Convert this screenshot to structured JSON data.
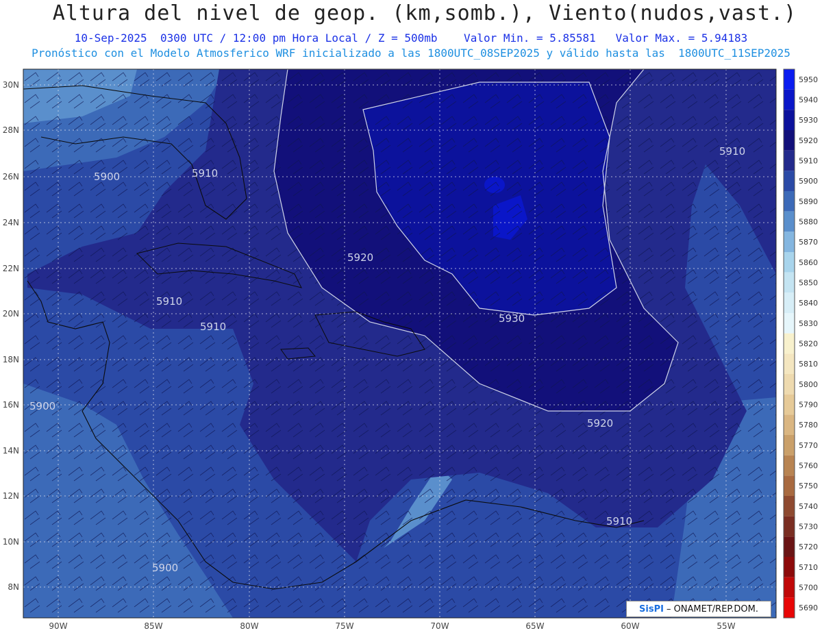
{
  "header": {
    "title": "Altura del nivel de geop. (km,somb.), Viento(nudos,vast.)",
    "line1": "10-Sep-2025  0300 UTC / 12:00 pm Hora Local / Z = 500mb    Valor Min. = 5.85581   Valor Max. = 5.94183",
    "line2": "Pronóstico con el Modelo Atmosferico WRF inicializado a las 1800UTC_08SEP2025 y válido hasta las  1800UTC_11SEP2025"
  },
  "axes": {
    "lat_labels": [
      "30N",
      "28N",
      "26N",
      "24N",
      "22N",
      "20N",
      "18N",
      "16N",
      "14N",
      "12N",
      "10N",
      "8N"
    ],
    "lon_labels": [
      "90W",
      "85W",
      "80W",
      "75W",
      "70W",
      "65W",
      "60W",
      "55W"
    ]
  },
  "contour_labels": [
    "5900",
    "5910",
    "5910",
    "5910",
    "5920",
    "5930",
    "5920",
    "5910",
    "5910",
    "5900",
    "5900"
  ],
  "colorbar": {
    "levels": [
      "5950",
      "5940",
      "5930",
      "5920",
      "5910",
      "5900",
      "5890",
      "5880",
      "5870",
      "5860",
      "5850",
      "5840",
      "5830",
      "5820",
      "5810",
      "5800",
      "5790",
      "5780",
      "5770",
      "5760",
      "5750",
      "5740",
      "5730",
      "5720",
      "5710",
      "5700",
      "5690"
    ],
    "colors": [
      "#0a1cf0",
      "#0a16c8",
      "#0c129c",
      "#12107a",
      "#232a8c",
      "#2b4aa6",
      "#3c6ab8",
      "#5a8fcc",
      "#84b6e0",
      "#a8d4ec",
      "#c4e4f2",
      "#d7eef7",
      "#e6f6fb",
      "#f8f1cd",
      "#f4e6c0",
      "#eedaaf",
      "#e6ca98",
      "#dab682",
      "#caa06a",
      "#b88452",
      "#a86a40",
      "#8e4a30",
      "#7a2e22",
      "#6a1414",
      "#8c0a0a",
      "#c00808",
      "#e80606"
    ]
  },
  "credit": {
    "brand": "SisPI",
    "org": "– ONAMET/REP.DOM."
  },
  "colors": {
    "deep": "#12107a",
    "mid": "#232a8c",
    "base": "#2b4aa6",
    "light": "#3c6ab8",
    "lighter": "#5a8fcc",
    "max": "#0c18c8"
  }
}
